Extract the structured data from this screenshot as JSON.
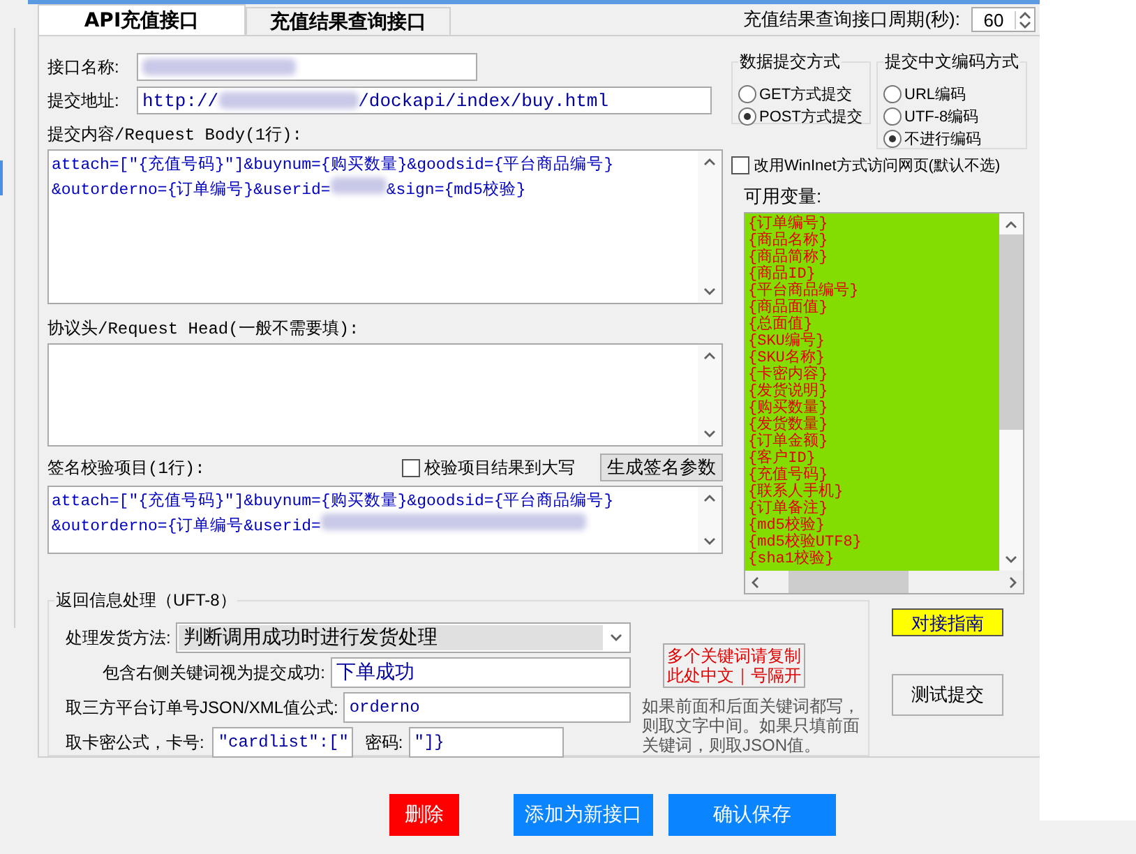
{
  "tabs": [
    {
      "label": "API充值接口",
      "selected": true
    },
    {
      "label": "充值结果查询接口",
      "selected": false
    }
  ],
  "query_period": {
    "label": "充值结果查询接口周期(秒):",
    "value": "60"
  },
  "form": {
    "name_label": "接口名称:",
    "url_label": "提交地址:",
    "url_start": "http://",
    "url_end": "/dockapi/index/buy.html",
    "body_label": "提交内容/Request Body(1行):",
    "body_lines": [
      "attach=[\"{充值号码}\"]&buynum={购买数量}&goodsid={平台商品编号}",
      "&outorderno={订单编号}&userid="
    ],
    "body_tail": "&sign={md5校验}",
    "head_label": "协议头/Request Head(一般不需要填):",
    "sign_label": "签名校验项目(1行):",
    "sign_uppercase": {
      "label": "校验项目结果到大写",
      "checked": false
    },
    "sign_button": "生成签名参数",
    "sign_lines": [
      "attach=[\"{充值号码}\"]&buynum={购买数量}&goodsid={平台商品编号}",
      "&outorderno={订单编号&userid="
    ]
  },
  "submit_method": {
    "title": "数据提交方式",
    "options": [
      {
        "label": "GET方式提交",
        "selected": false
      },
      {
        "label": "POST方式提交",
        "selected": true
      }
    ]
  },
  "encoding": {
    "title": "提交中文编码方式",
    "options": [
      {
        "label": "URL编码",
        "selected": false
      },
      {
        "label": "UTF-8编码",
        "selected": false
      },
      {
        "label": "不进行编码",
        "selected": true
      }
    ]
  },
  "wininet": {
    "label": "改用WinInet方式访问网页(默认不选)",
    "checked": false
  },
  "variables": {
    "label": "可用变量:",
    "items": [
      "{订单编号}",
      "{商品名称}",
      "{商品简称}",
      "{商品ID}",
      "{平台商品编号}",
      "{商品面值}",
      "{总面值}",
      "{SKU编号}",
      "{SKU名称}",
      "{卡密内容}",
      "{发货说明}",
      "{购买数量}",
      "{发货数量}",
      "{订单金额}",
      "{客户ID}",
      "{充值号码}",
      "{联系人手机}",
      "{订单备注}",
      "{md5校验}",
      "{md5校验UTF8}",
      "{sha1校验}"
    ]
  },
  "response": {
    "title": "返回信息处理（UFT-8）",
    "method_label": "处理发货方法:",
    "method_value": "判断调用成功时进行发货处理",
    "success_label": "包含右侧关键词视为提交成功:",
    "success_value": "下单成功",
    "order_label": "取三方平台订单号JSON/XML值公式:",
    "order_value": "orderno",
    "card_label": "取卡密公式，卡号:",
    "card_value": "\"cardlist\":[\"",
    "password_label": "密码:",
    "password_value": "\"]}",
    "note_lines": [
      "多个关键词请复制",
      "此处中文｜号隔开"
    ],
    "hint": "如果前面和后面关键词都写，则取文字中间。如果只填前面关键词，则取JSON值。"
  },
  "guide_button": "对接指南",
  "test_button": "测试提交",
  "footer_buttons": [
    {
      "label": "删除",
      "kind": "danger"
    },
    {
      "label": "添加为新接口",
      "kind": "primary"
    },
    {
      "label": "确认保存",
      "kind": "primary"
    }
  ]
}
